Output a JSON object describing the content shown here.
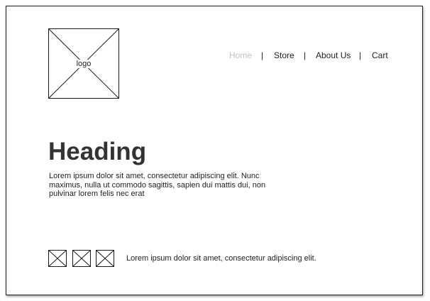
{
  "logo": {
    "label": "logo"
  },
  "nav": {
    "items": [
      {
        "label": "Home",
        "active": true
      },
      {
        "label": "Store",
        "active": false
      },
      {
        "label": "About Us",
        "active": false
      },
      {
        "label": "Cart",
        "active": false
      }
    ],
    "separator": "|"
  },
  "hero": {
    "heading": "Heading",
    "text": "Lorem ipsum dolor sit amet, consectetur adipiscing elit. Nunc maximus, nulla ut commodo sagittis, sapien dui mattis dui, non pulvinar lorem felis nec erat"
  },
  "footer": {
    "text": "Lorem ipsum dolor sit amet, consectetur adipiscing elit."
  },
  "colors": {
    "active_nav": "#c2c2c2",
    "text": "#222222",
    "heading": "#333333"
  }
}
